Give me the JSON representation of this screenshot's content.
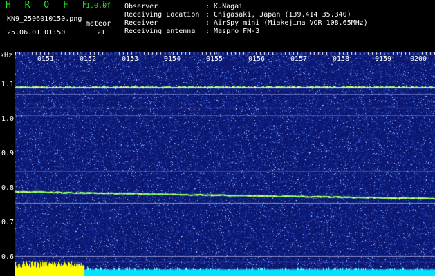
{
  "header": {
    "brand": "H R O F F T",
    "version": "1.0.0f",
    "filename": "KN9_2506010150.png",
    "datetime": "25.06.01 01:50",
    "meteor_label": "meteor",
    "meteor_count": "21"
  },
  "info": {
    "observer_label": "Observer",
    "observer_value": ": K.Nagai",
    "location_label": "Receiving Location",
    "location_value": ": Chigasaki, Japan (139.414 35.340)",
    "receiver_label": "Receiver",
    "receiver_value": ": AirSpy mini (Miakejima VOR 108.65MHz)",
    "antenna_label": "Receiving antenna",
    "antenna_value": ": Maspro FM-3"
  },
  "axis": {
    "unit": "kHz",
    "y_ticks": [
      "1.1",
      "1.0",
      "0.9",
      "0.8",
      "0.7",
      "0.6"
    ],
    "x_ticks": [
      "0151",
      "0152",
      "0153",
      "0154",
      "0155",
      "0156",
      "0157",
      "0158",
      "0159",
      "0200"
    ]
  },
  "colors": {
    "background": "#0a1670",
    "signal": "#7fff4f",
    "meteor": "#ffff00",
    "bottom_band": "#00e5ff"
  }
}
